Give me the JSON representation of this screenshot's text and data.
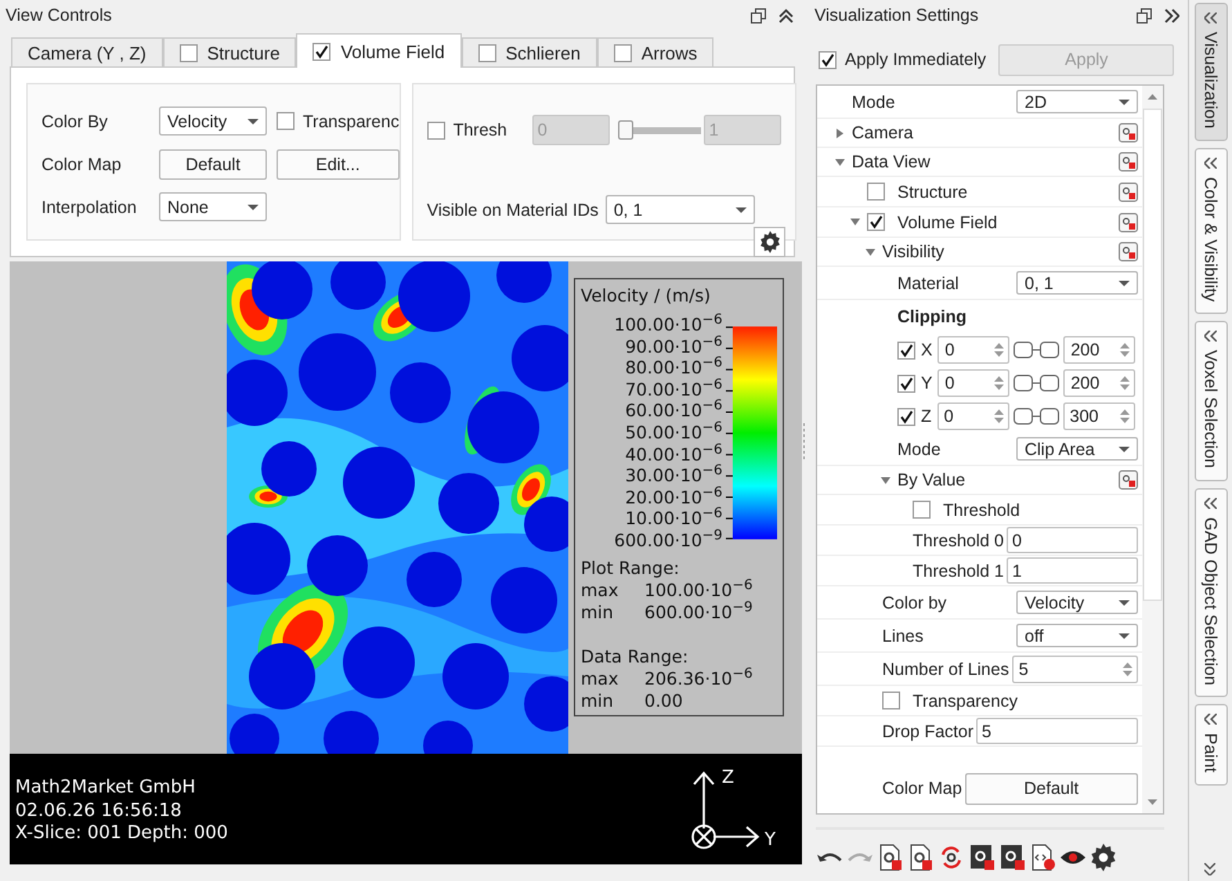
{
  "view_controls": {
    "title": "View Controls",
    "tabs": [
      {
        "label": "Camera (Y , Z)",
        "kind": "plain",
        "selected": false
      },
      {
        "label": "Structure",
        "kind": "check",
        "checked": false,
        "selected": false
      },
      {
        "label": "Volume Field",
        "kind": "check",
        "checked": true,
        "selected": true
      },
      {
        "label": "Schlieren",
        "kind": "check",
        "checked": false,
        "selected": false
      },
      {
        "label": "Arrows",
        "kind": "check",
        "checked": false,
        "selected": false
      }
    ],
    "color_by_label": "Color By",
    "color_by": "Velocity",
    "transparency_label": "Transparenc",
    "transparency_checked": false,
    "color_map_label": "Color Map",
    "color_map": "Default",
    "edit_button": "Edit...",
    "interpolation_label": "Interpolation",
    "interpolation": "None",
    "threshold": {
      "label": "Thresh",
      "checked": false,
      "disabled": true,
      "min": "0",
      "max": "1",
      "level": 0
    },
    "material_label": "Visible on Material IDs",
    "material": "0, 1"
  },
  "viewport": {
    "legend": {
      "title": "Velocity / (m/s)",
      "ticks": [
        "100.00·10$^{−6}$",
        "90.00·10$^{−6}$",
        "80.00·10$^{−6}$",
        "70.00·10$^{−6}$",
        "60.00·10$^{−6}$",
        "50.00·10$^{−6}$",
        "40.00·10$^{−6}$",
        "30.00·10$^{−6}$",
        "20.00·10$^{−6}$",
        "10.00·10$^{−6}$",
        "600.00·10$^{−9}$"
      ],
      "sections": [
        {
          "title": "Plot Range:",
          "rows": [
            {
              "label": "max",
              "value": "100.00·10$^{−6}$"
            },
            {
              "label": "min",
              "value": "600.00·10$^{−9}$"
            }
          ]
        },
        {
          "title": "Data Range:",
          "rows": [
            {
              "label": "max",
              "value": "206.36·10$^{−6}$"
            },
            {
              "label": "min",
              "value": "0.00"
            }
          ]
        }
      ]
    },
    "info": [
      "Math2Market GmbH",
      "02.06.26 16:56:18",
      "X-Slice: 001 Depth: 000"
    ],
    "axes": {
      "up": "Z",
      "right": "Y"
    }
  },
  "settings": {
    "title": "Visualization Settings",
    "apply_immediately": {
      "label": "Apply Immediately",
      "checked": true
    },
    "apply_button": {
      "label": "Apply",
      "disabled": true
    },
    "tree": [
      {
        "kind": "select",
        "label": "Mode",
        "value": "2D"
      },
      {
        "kind": "group",
        "label": "Camera",
        "expanded": false,
        "reset": true
      },
      {
        "kind": "group",
        "label": "Data View",
        "expanded": true,
        "reset": true,
        "children": [
          {
            "kind": "check",
            "label": "Structure",
            "checked": false,
            "reset": true
          },
          {
            "kind": "check",
            "label": "Volume Field",
            "checked": true,
            "expanded": true,
            "reset": true,
            "children": [
              {
                "kind": "group",
                "label": "Visibility",
                "expanded": true,
                "reset": true,
                "children": [
                  {
                    "kind": "select",
                    "label": "Material",
                    "value": "0, 1"
                  },
                  {
                    "kind": "heading",
                    "label": "Clipping"
                  },
                  {
                    "kind": "clip",
                    "axis": "X",
                    "checked": true,
                    "min": "0",
                    "max": "200",
                    "level": 1
                  },
                  {
                    "kind": "clip",
                    "axis": "Y",
                    "checked": true,
                    "min": "0",
                    "max": "200",
                    "level": 1
                  },
                  {
                    "kind": "clip",
                    "axis": "Z",
                    "checked": true,
                    "min": "0",
                    "max": "300",
                    "level": 1
                  },
                  {
                    "kind": "select",
                    "label": "Mode",
                    "value": "Clip Area"
                  },
                  {
                    "kind": "group",
                    "label": "By Value",
                    "expanded": true,
                    "reset": true,
                    "children": [
                      {
                        "kind": "check",
                        "label": "Threshold",
                        "checked": false
                      },
                      {
                        "kind": "text",
                        "label": "Threshold 0",
                        "value": "0"
                      },
                      {
                        "kind": "text",
                        "label": "Threshold 1",
                        "value": "1"
                      }
                    ]
                  }
                ]
              },
              {
                "kind": "select",
                "label": "Color by",
                "value": "Velocity"
              },
              {
                "kind": "select",
                "label": "Lines",
                "value": "off"
              },
              {
                "kind": "spin",
                "label": "Number of Lines",
                "value": "5"
              },
              {
                "kind": "check",
                "label": "Transparency",
                "checked": false
              },
              {
                "kind": "text",
                "label": "Drop Factor",
                "value": "5"
              },
              {
                "kind": "button",
                "label": "Color Map",
                "value": "Default"
              }
            ]
          }
        ]
      }
    ]
  },
  "side_tabs": [
    {
      "label": "Visualization",
      "selected": true
    },
    {
      "label": "Color & Visibility",
      "selected": false
    },
    {
      "label": "Voxel Selection",
      "selected": false
    },
    {
      "label": "GAD Object Selection",
      "selected": false
    },
    {
      "label": "Paint",
      "selected": false
    }
  ]
}
